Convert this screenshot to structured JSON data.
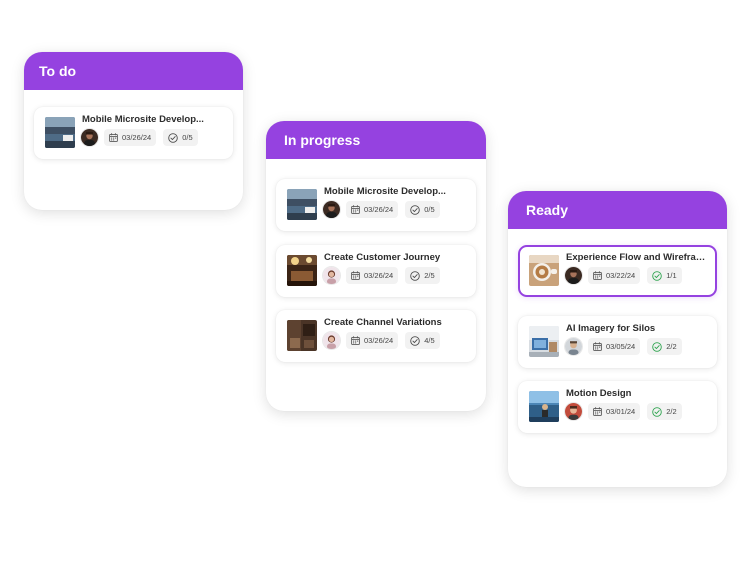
{
  "colors": {
    "accent": "#9542e0",
    "check_done": "#2da44e",
    "check_pending": "#4b4b4b"
  },
  "columns": [
    {
      "title": "To do",
      "cards": [
        {
          "title": "Mobile Microsite Develop...",
          "date": "03/26/24",
          "progress": "0/5",
          "thumb": "thumb-lake",
          "avatar": "avatar-dark",
          "complete": false,
          "selected": false
        }
      ]
    },
    {
      "title": "In progress",
      "cards": [
        {
          "title": "Mobile Microsite Develop...",
          "date": "03/26/24",
          "progress": "0/5",
          "thumb": "thumb-lake",
          "avatar": "avatar-dark",
          "complete": false,
          "selected": false
        },
        {
          "title": "Create Customer Journey",
          "date": "03/26/24",
          "progress": "2/5",
          "thumb": "thumb-cafe",
          "avatar": "avatar-woman",
          "complete": false,
          "selected": false
        },
        {
          "title": "Create Channel Variations",
          "date": "03/26/24",
          "progress": "4/5",
          "thumb": "thumb-wood",
          "avatar": "avatar-woman",
          "complete": false,
          "selected": false
        }
      ]
    },
    {
      "title": "Ready",
      "cards": [
        {
          "title": "Experience Flow and Wireframes",
          "date": "03/22/24",
          "progress": "1/1",
          "thumb": "thumb-coffee",
          "avatar": "avatar-dark",
          "complete": true,
          "selected": true
        },
        {
          "title": "AI Imagery for Silos",
          "date": "03/05/24",
          "progress": "2/2",
          "thumb": "thumb-desk",
          "avatar": "avatar-man",
          "complete": true,
          "selected": false
        },
        {
          "title": "Motion Design",
          "date": "03/01/24",
          "progress": "2/2",
          "thumb": "thumb-coast",
          "avatar": "avatar-smile",
          "complete": true,
          "selected": false
        }
      ]
    }
  ]
}
